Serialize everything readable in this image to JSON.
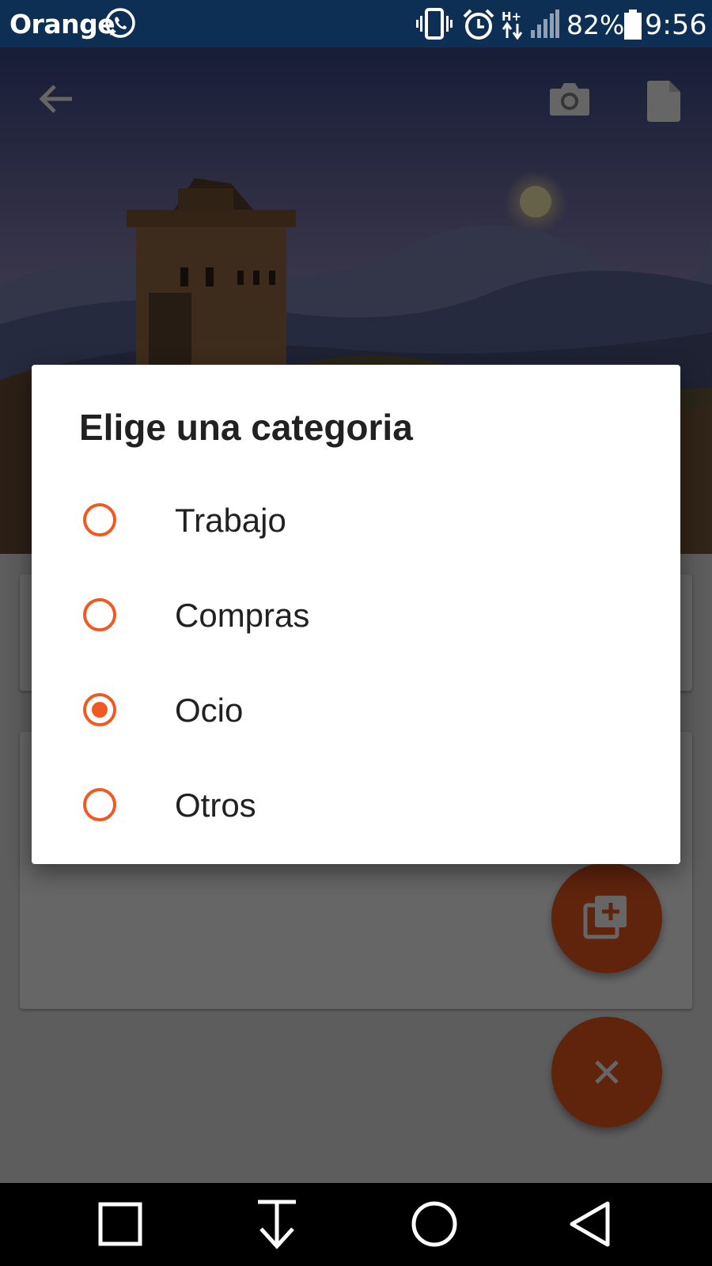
{
  "status_bar": {
    "carrier": "Orange",
    "battery_percent": "82%",
    "time": "9:56",
    "network_type": "H+",
    "icons": [
      "whatsapp-icon",
      "vibrate-icon",
      "alarm-icon",
      "data-arrows-icon",
      "signal-icon",
      "battery-icon"
    ]
  },
  "app_bar": {
    "icons": [
      "back-arrow-icon",
      "camera-icon",
      "document-icon"
    ]
  },
  "dialog": {
    "title": "Elige una categoria",
    "options": [
      {
        "label": "Trabajo",
        "selected": false
      },
      {
        "label": "Compras",
        "selected": false
      },
      {
        "label": "Ocio",
        "selected": true
      },
      {
        "label": "Otros",
        "selected": false
      }
    ]
  },
  "fabs": [
    "add-to-library-icon",
    "close-icon"
  ],
  "nav_bar": {
    "icons": [
      "recent-apps-icon",
      "notifications-pull-icon",
      "home-icon",
      "back-icon"
    ]
  },
  "colors": {
    "accent": "#f05a22",
    "status_bar": "#0d2f54",
    "dialog_background": "#ffffff",
    "scrim": "rgba(0,0,0,0.6)"
  }
}
